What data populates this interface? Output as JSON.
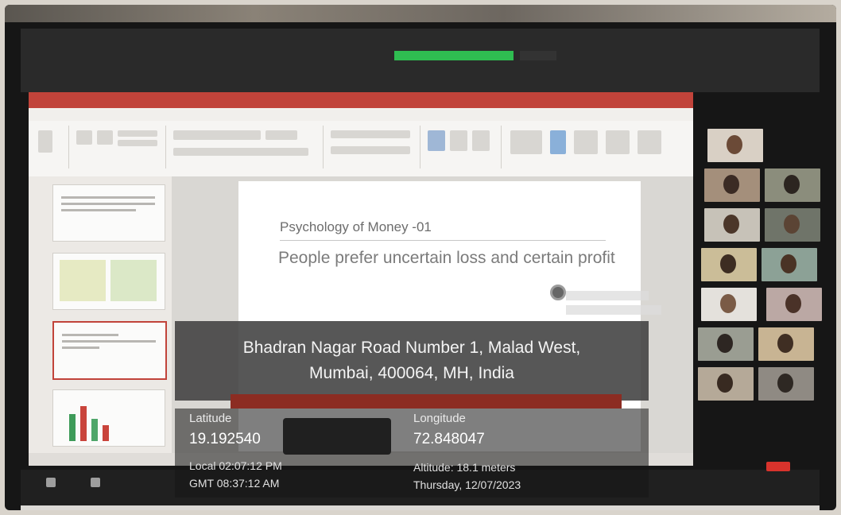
{
  "slide": {
    "heading": "Psychology of Money -01",
    "body": "People prefer uncertain loss and certain profit"
  },
  "geotag": {
    "address_line1": "Bhadran Nagar Road Number 1, Malad West,",
    "address_line2": "Mumbai, 400064, MH, India",
    "latitude_label": "Latitude",
    "latitude_value": "19.192540",
    "longitude_label": "Longitude",
    "longitude_value": "72.848047",
    "local_time": "Local 02:07:12 PM",
    "gmt_time": "GMT 08:37:12 AM",
    "altitude": "Altitude: 18.1 meters",
    "date": "Thursday, 12/07/2023"
  },
  "colors": {
    "ppt_accent": "#c1433a",
    "zoom_share_green": "#2fbd51",
    "leave_red": "#d8332c",
    "overlay_bg": "#404040"
  },
  "icons": {
    "cursor": "pointer-dot-icon"
  }
}
